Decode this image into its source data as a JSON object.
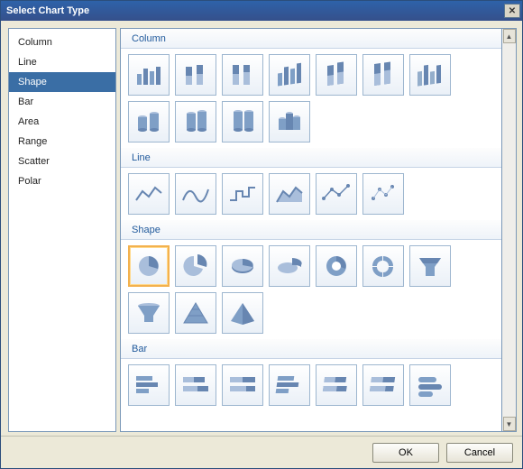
{
  "title": "Select Chart Type",
  "sidebar": {
    "items": [
      {
        "label": "Column"
      },
      {
        "label": "Line"
      },
      {
        "label": "Shape"
      },
      {
        "label": "Bar"
      },
      {
        "label": "Area"
      },
      {
        "label": "Range"
      },
      {
        "label": "Scatter"
      },
      {
        "label": "Polar"
      }
    ],
    "selected_index": 2
  },
  "sections": {
    "column": {
      "label": "Column"
    },
    "line": {
      "label": "Line"
    },
    "shape": {
      "label": "Shape"
    },
    "bar": {
      "label": "Bar"
    }
  },
  "gallery": {
    "selected_shape_index": 0
  },
  "buttons": {
    "ok": "OK",
    "cancel": "Cancel"
  },
  "icons": {
    "close": "✕",
    "scroll_up": "▲",
    "scroll_down": "▼"
  }
}
